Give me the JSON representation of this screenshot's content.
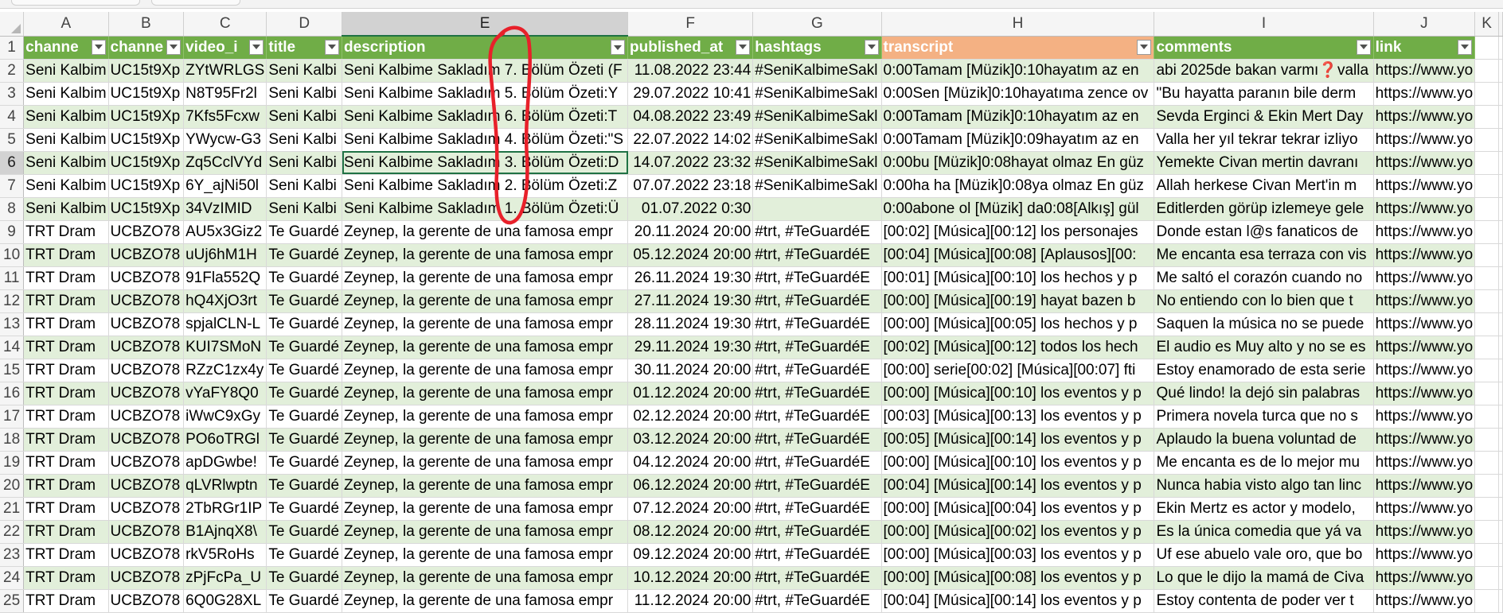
{
  "columns": [
    "A",
    "B",
    "C",
    "D",
    "E",
    "F",
    "G",
    "H",
    "I",
    "J",
    "K"
  ],
  "headers": [
    "channe",
    "channe",
    "video_i",
    "title",
    "description",
    "published_at",
    "hashtags",
    "transcript",
    "comments",
    "link"
  ],
  "rows": [
    {
      "n": "2",
      "cells": [
        "Seni Kalbim",
        "UC15t9Xp",
        "ZYtWRLGS",
        "Seni Kalbi",
        "Seni Kalbime Sakladım 7. Bölüm Özeti (F",
        "11.08.2022 23:44",
        "#SeniKalbimeSakl",
        "0:00Tamam [Müzik]0:10hayatım az en",
        "abi 2025de bakan varmı❓valla",
        "https://www.yo"
      ]
    },
    {
      "n": "3",
      "cells": [
        "Seni Kalbim",
        "UC15t9Xp",
        "N8T95Fr2l",
        "Seni Kalbi",
        "Seni Kalbime Sakladım 5. Bölüm Özeti:Y",
        "29.07.2022 10:41",
        "#SeniKalbimeSakl",
        "0:00Sen [Müzik]0:10hayatıma zence ov",
        "\"Bu hayatta paranın bile derm",
        "https://www.yo"
      ]
    },
    {
      "n": "4",
      "cells": [
        "Seni Kalbim",
        "UC15t9Xp",
        "7Kfs5Fcxw",
        "Seni Kalbi",
        "Seni Kalbime Sakladım 6. Bölüm Özeti:T",
        "04.08.2022 23:49",
        "#SeniKalbimeSakl",
        "0:00Tamam [Müzik]0:10hayatım az en",
        "Sevda Erginci & Ekin Mert Day",
        "https://www.yo"
      ]
    },
    {
      "n": "5",
      "cells": [
        "Seni Kalbim",
        "UC15t9Xp",
        "YWycw-G3",
        "Seni Kalbi",
        "Seni Kalbime Sakladım 4. Bölüm Özeti:\"S",
        "22.07.2022 14:02",
        "#SeniKalbimeSakl",
        "0:00Tamam [Müzik]0:09hayatım az en",
        "Valla her yıl tekrar tekrar izliyo",
        "https://www.yo"
      ]
    },
    {
      "n": "6",
      "cells": [
        "Seni Kalbim",
        "UC15t9Xp",
        "Zq5CclVYd",
        "Seni Kalbi",
        "Seni Kalbime Sakladım 3. Bölüm Özeti:D",
        "14.07.2022 23:32",
        "#SeniKalbimeSakl",
        "0:00bu [Müzik]0:08hayat olmaz En güz",
        "Yemekte Civan mertin davranı",
        "https://www.yo"
      ]
    },
    {
      "n": "7",
      "cells": [
        "Seni Kalbim",
        "UC15t9Xp",
        "6Y_ajNi50l",
        "Seni Kalbi",
        "Seni Kalbime Sakladım 2. Bölüm Özeti:Z",
        "07.07.2022 23:18",
        "#SeniKalbimeSakl",
        "0:00ha ha [Müzik]0:08ya olmaz En güz",
        "Allah herkese Civan Mert'in m",
        "https://www.yo"
      ]
    },
    {
      "n": "8",
      "cells": [
        "Seni Kalbim",
        "UC15t9Xp",
        "34VzIMID",
        "Seni Kalbi",
        "Seni Kalbime Sakladım 1. Bölüm Özeti:Ü",
        "01.07.2022 0:30",
        "",
        "0:00abone ol [Müzik] da0:08[Alkış] gül",
        "Editlerden görüp izlemeye gele",
        "https://www.yo"
      ]
    },
    {
      "n": "9",
      "cells": [
        "TRT Dram",
        "UCBZO78",
        "AU5x3Giz2",
        "Te Guardé",
        "Zeynep, la gerente de una famosa empr",
        "20.11.2024 20:00",
        "#trt, #TeGuardéE",
        "[00:02] [Música][00:12] los personajes",
        "Donde estan l@s fanaticos de",
        "https://www.yo"
      ]
    },
    {
      "n": "10",
      "cells": [
        "TRT Dram",
        "UCBZO78",
        "uUj6hM1H",
        "Te Guardé",
        "Zeynep, la gerente de una famosa empr",
        "05.12.2024 20:00",
        "#trt, #TeGuardéE",
        "[00:04] [Música][00:08] [Aplausos][00:",
        "Me encanta esa terraza con vis",
        "https://www.yo"
      ]
    },
    {
      "n": "11",
      "cells": [
        "TRT Dram",
        "UCBZO78",
        "91Fla552Q",
        "Te Guardé",
        "Zeynep, la gerente de una famosa empr",
        "26.11.2024 19:30",
        "#trt, #TeGuardéE",
        "[00:01] [Música][00:10] los hechos y p",
        "Me saltó el corazón cuando no",
        "https://www.yo"
      ]
    },
    {
      "n": "12",
      "cells": [
        "TRT Dram",
        "UCBZO78",
        "hQ4XjO3rt",
        "Te Guardé",
        "Zeynep, la gerente de una famosa empr",
        "27.11.2024 19:30",
        "#trt, #TeGuardéE",
        "[00:00] [Música][00:19] hayat bazen b",
        "No entiendo con lo bien que t",
        "https://www.yo"
      ]
    },
    {
      "n": "13",
      "cells": [
        "TRT Dram",
        "UCBZO78",
        "spjalCLN-L",
        "Te Guardé",
        "Zeynep, la gerente de una famosa empr",
        "28.11.2024 19:30",
        "#trt, #TeGuardéE",
        "[00:00] [Música][00:05] los hechos y p",
        "Saquen la música no se puede",
        "https://www.yo"
      ]
    },
    {
      "n": "14",
      "cells": [
        "TRT Dram",
        "UCBZO78",
        "KUI7SMoN",
        "Te Guardé",
        "Zeynep, la gerente de una famosa empr",
        "29.11.2024 19:30",
        "#trt, #TeGuardéE",
        "[00:02] [Música][00:12] todos los hech",
        "El audio es Muy alto y no se es",
        "https://www.yo"
      ]
    },
    {
      "n": "15",
      "cells": [
        "TRT Dram",
        "UCBZO78",
        "RZzC1zx4y",
        "Te Guardé",
        "Zeynep, la gerente de una famosa empr",
        "30.11.2024 20:00",
        "#trt, #TeGuardéE",
        "[00:00] serie[00:02] [Música][00:07] fti",
        "Estoy enamorado de esta serie",
        "https://www.yo"
      ]
    },
    {
      "n": "16",
      "cells": [
        "TRT Dram",
        "UCBZO78",
        "vYaFY8Q0",
        "Te Guardé",
        "Zeynep, la gerente de una famosa empr",
        "01.12.2024 20:00",
        "#trt, #TeGuardéE",
        "[00:00] [Música][00:10] los eventos y p",
        "Qué lindo! la dejó sin palabras",
        "https://www.yo"
      ]
    },
    {
      "n": "17",
      "cells": [
        "TRT Dram",
        "UCBZO78",
        "iWwC9xGy",
        "Te Guardé",
        "Zeynep, la gerente de una famosa empr",
        "02.12.2024 20:00",
        "#trt, #TeGuardéE",
        "[00:03] [Música][00:13] los eventos y p",
        "Primera novela turca que no s",
        "https://www.yo"
      ]
    },
    {
      "n": "18",
      "cells": [
        "TRT Dram",
        "UCBZO78",
        "PO6oTRGl",
        "Te Guardé",
        "Zeynep, la gerente de una famosa empr",
        "03.12.2024 20:00",
        "#trt, #TeGuardéE",
        "[00:05] [Música][00:14] los eventos y p",
        "Aplaudo la buena voluntad de",
        "https://www.yo"
      ]
    },
    {
      "n": "19",
      "cells": [
        "TRT Dram",
        "UCBZO78",
        "apDGwbe!",
        "Te Guardé",
        "Zeynep, la gerente de una famosa empr",
        "04.12.2024 20:00",
        "#trt, #TeGuardéE",
        "[00:00] [Música][00:10] los eventos y p",
        "Me encanta es de lo mejor mu",
        "https://www.yo"
      ]
    },
    {
      "n": "20",
      "cells": [
        "TRT Dram",
        "UCBZO78",
        "qLVRlwptn",
        "Te Guardé",
        "Zeynep, la gerente de una famosa empr",
        "06.12.2024 20:00",
        "#trt, #TeGuardéE",
        "[00:04] [Música][00:14] los eventos y p",
        "Nunca habia visto algo tan linc",
        "https://www.yo"
      ]
    },
    {
      "n": "21",
      "cells": [
        "TRT Dram",
        "UCBZO78",
        "2TbRGr1IP",
        "Te Guardé",
        "Zeynep, la gerente de una famosa empr",
        "07.12.2024 20:00",
        "#trt, #TeGuardéE",
        "[00:00] [Música][00:04] los eventos y p",
        "Ekin Mertz es actor y modelo,",
        "https://www.yo"
      ]
    },
    {
      "n": "22",
      "cells": [
        "TRT Dram",
        "UCBZO78",
        "B1AjnqX8\\",
        "Te Guardé",
        "Zeynep, la gerente de una famosa empr",
        "08.12.2024 20:00",
        "#trt, #TeGuardéE",
        "[00:00] [Música][00:02] los eventos y p",
        "Es la única comedia que yá va",
        "https://www.yo"
      ]
    },
    {
      "n": "23",
      "cells": [
        "TRT Dram",
        "UCBZO78",
        "rkV5RoHs",
        "Te Guardé",
        "Zeynep, la gerente de una famosa empr",
        "09.12.2024 20:00",
        "#trt, #TeGuardéE",
        "[00:00] [Música][00:03] los eventos y p",
        "Uf ese abuelo vale oro, que bo",
        "https://www.yo"
      ]
    },
    {
      "n": "24",
      "cells": [
        "TRT Dram",
        "UCBZO78",
        "zPjFcPa_U",
        "Te Guardé",
        "Zeynep, la gerente de una famosa empr",
        "10.12.2024 20:00",
        "#trt, #TeGuardéE",
        "[00:00] [Música][00:08] los eventos y p",
        "Lo que le dijo la mamá de Civa",
        "https://www.yo"
      ]
    },
    {
      "n": "25",
      "cells": [
        "TRT Dram",
        "UCBZO78",
        "6Q0G28XL",
        "Te Guardé",
        "Zeynep, la gerente de una famosa empr",
        "11.12.2024 20:00",
        "#trt, #TeGuardéE",
        "[00:04] [Música][00:14] los eventos y p",
        "Estoy contenta de poder ver t",
        "https://www.yo"
      ]
    }
  ],
  "header_row_number": "1",
  "colors": {
    "header_green": "#70ad47",
    "header_orange": "#f4b183",
    "band_green": "#e2efda",
    "selection": "#1f7244",
    "annotation_red": "#e8202a"
  }
}
